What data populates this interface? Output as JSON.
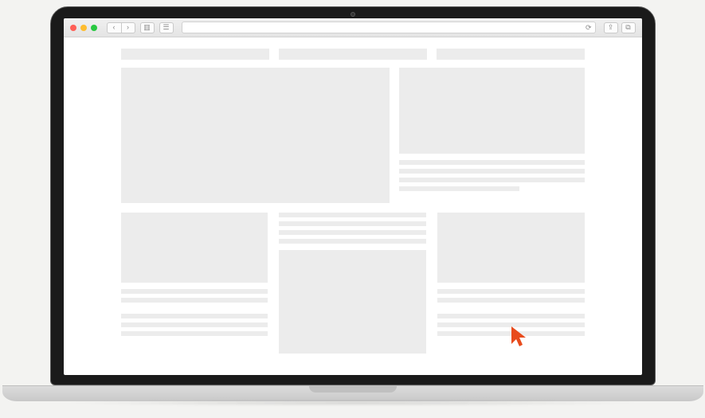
{
  "traffic_lights": {
    "red": "#ff5f57",
    "yellow": "#febc2e",
    "green": "#28c840"
  },
  "nav": {
    "back_glyph": "‹",
    "forward_glyph": "›",
    "sidebar_glyph": "▥",
    "bookmarks_glyph": "☰",
    "refresh_glyph": "⟳",
    "share_glyph": "⇪",
    "tabs_glyph": "⧉"
  },
  "cursor_color": "#e84b1c"
}
